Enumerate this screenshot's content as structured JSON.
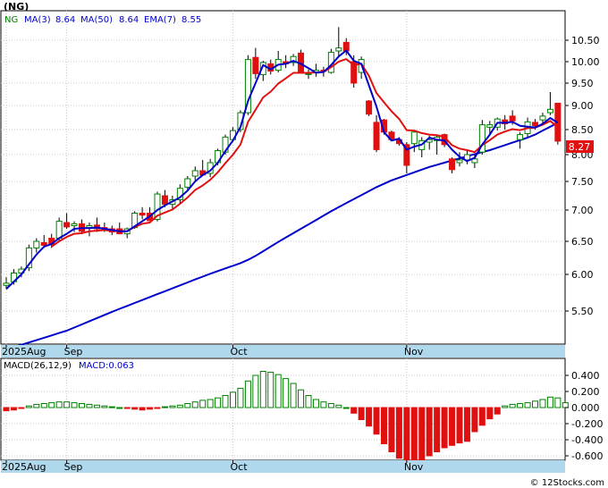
{
  "chart_data": [
    {
      "type": "candlestick",
      "symbol": "(NG)",
      "legend": [
        {
          "text": "NG",
          "color": "#008000"
        },
        {
          "text": "MA(3)",
          "color": "#0000cc"
        },
        {
          "text": "8.64",
          "color": "#0000cc"
        },
        {
          "text": "MA(50)",
          "color": "#0000cc"
        },
        {
          "text": "8.64",
          "color": "#0000cc"
        },
        {
          "text": "EMA(7)",
          "color": "#0000cc"
        },
        {
          "text": "8.55",
          "color": "#0000cc"
        }
      ],
      "last_price": "8.27",
      "y_ticks": [
        "10.50",
        "10.00",
        "9.50",
        "9.00",
        "8.50",
        "8.00",
        "7.50",
        "7.00",
        "6.50",
        "6.00",
        "5.50"
      ],
      "y_tick_values": [
        10.5,
        10.0,
        9.5,
        9.0,
        8.5,
        8.0,
        7.5,
        7.0,
        6.5,
        6.0,
        5.5
      ],
      "x_labels": [
        {
          "label": "2025Aug",
          "index": 0
        },
        {
          "label": "Sep",
          "index": 8
        },
        {
          "label": "Oct",
          "index": 30
        },
        {
          "label": "Nov",
          "index": 53
        }
      ],
      "candles": [
        [
          5.85,
          5.96,
          5.8,
          5.88
        ],
        [
          5.9,
          6.08,
          5.86,
          6.02
        ],
        [
          6.02,
          6.12,
          5.96,
          6.08
        ],
        [
          6.1,
          6.45,
          6.05,
          6.4
        ],
        [
          6.4,
          6.55,
          6.33,
          6.5
        ],
        [
          6.48,
          6.6,
          6.4,
          6.44
        ],
        [
          6.55,
          6.62,
          6.4,
          6.45
        ],
        [
          6.55,
          6.88,
          6.5,
          6.82
        ],
        [
          6.8,
          6.95,
          6.7,
          6.73
        ],
        [
          6.75,
          6.82,
          6.65,
          6.78
        ],
        [
          6.78,
          6.85,
          6.62,
          6.66
        ],
        [
          6.72,
          6.8,
          6.58,
          6.75
        ],
        [
          6.76,
          6.88,
          6.65,
          6.7
        ],
        [
          6.72,
          6.8,
          6.65,
          6.7
        ],
        [
          6.7,
          6.75,
          6.6,
          6.65
        ],
        [
          6.7,
          6.8,
          6.62,
          6.62
        ],
        [
          6.62,
          6.72,
          6.55,
          6.7
        ],
        [
          6.72,
          6.98,
          6.7,
          6.95
        ],
        [
          6.95,
          7.05,
          6.85,
          6.92
        ],
        [
          6.95,
          7.05,
          6.88,
          6.83
        ],
        [
          6.85,
          7.32,
          6.82,
          7.28
        ],
        [
          7.25,
          7.35,
          7.05,
          7.1
        ],
        [
          7.1,
          7.25,
          7.02,
          7.18
        ],
        [
          7.18,
          7.45,
          7.1,
          7.38
        ],
        [
          7.4,
          7.6,
          7.35,
          7.55
        ],
        [
          7.6,
          7.78,
          7.52,
          7.7
        ],
        [
          7.7,
          7.9,
          7.6,
          7.62
        ],
        [
          7.65,
          7.92,
          7.58,
          7.85
        ],
        [
          7.85,
          8.12,
          7.8,
          8.08
        ],
        [
          8.05,
          8.4,
          8.0,
          8.35
        ],
        [
          8.3,
          8.55,
          8.25,
          8.48
        ],
        [
          8.5,
          8.9,
          8.45,
          8.85
        ],
        [
          8.85,
          10.15,
          8.8,
          10.05
        ],
        [
          10.1,
          10.32,
          9.6,
          9.72
        ],
        [
          9.7,
          10.02,
          9.55,
          9.98
        ],
        [
          9.95,
          10.05,
          9.7,
          9.78
        ],
        [
          9.8,
          10.25,
          9.75,
          10.05
        ],
        [
          10.0,
          10.15,
          9.85,
          9.95
        ],
        [
          9.98,
          10.18,
          9.9,
          10.12
        ],
        [
          10.2,
          10.28,
          9.72,
          9.76
        ],
        [
          9.7,
          9.82,
          9.6,
          9.72
        ],
        [
          9.75,
          9.95,
          9.65,
          9.8
        ],
        [
          9.8,
          9.88,
          9.65,
          9.78
        ],
        [
          9.75,
          10.3,
          9.72,
          10.22
        ],
        [
          10.25,
          10.82,
          10.1,
          10.32
        ],
        [
          10.45,
          10.55,
          10.15,
          10.25
        ],
        [
          10.0,
          10.15,
          9.4,
          9.5
        ],
        [
          9.75,
          10.12,
          9.6,
          10.05
        ],
        [
          9.1,
          9.12,
          8.78,
          8.82
        ],
        [
          8.65,
          8.8,
          8.05,
          8.1
        ],
        [
          8.7,
          8.72,
          8.4,
          8.45
        ],
        [
          8.45,
          8.48,
          8.28,
          8.3
        ],
        [
          8.3,
          8.35,
          8.18,
          8.22
        ],
        [
          8.2,
          8.25,
          7.65,
          7.8
        ],
        [
          8.22,
          8.48,
          8.05,
          8.45
        ],
        [
          8.1,
          8.35,
          7.95,
          8.28
        ],
        [
          8.25,
          8.38,
          8.1,
          8.3
        ],
        [
          8.28,
          8.4,
          8.0,
          8.35
        ],
        [
          8.4,
          8.42,
          8.15,
          8.2
        ],
        [
          7.92,
          7.95,
          7.65,
          7.72
        ],
        [
          7.85,
          8.05,
          7.78,
          7.9
        ],
        [
          7.9,
          8.1,
          7.82,
          8.0
        ],
        [
          7.85,
          8.0,
          7.75,
          7.92
        ],
        [
          8.05,
          8.7,
          8.0,
          8.6
        ],
        [
          8.55,
          8.68,
          8.42,
          8.6
        ],
        [
          8.55,
          8.75,
          8.48,
          8.72
        ],
        [
          8.7,
          8.8,
          8.5,
          8.62
        ],
        [
          8.78,
          8.9,
          8.6,
          8.68
        ],
        [
          8.3,
          8.45,
          8.12,
          8.4
        ],
        [
          8.42,
          8.75,
          8.35,
          8.66
        ],
        [
          8.65,
          8.72,
          8.5,
          8.58
        ],
        [
          8.7,
          8.85,
          8.62,
          8.78
        ],
        [
          8.85,
          9.3,
          8.8,
          8.92
        ],
        [
          9.05,
          9.05,
          8.2,
          8.27
        ]
      ],
      "series": [
        {
          "name": "MA(3)",
          "color": "#0000cc",
          "values": [
            5.8,
            5.9,
            6.0,
            6.15,
            6.3,
            6.42,
            6.46,
            6.55,
            6.62,
            6.7,
            6.71,
            6.71,
            6.72,
            6.7,
            6.68,
            6.66,
            6.66,
            6.74,
            6.82,
            6.9,
            7.0,
            7.08,
            7.15,
            7.22,
            7.34,
            7.5,
            7.62,
            7.7,
            7.85,
            8.07,
            8.28,
            8.55,
            9.1,
            9.5,
            9.92,
            9.82,
            9.93,
            9.95,
            10.02,
            9.95,
            9.85,
            9.74,
            9.76,
            9.92,
            10.12,
            10.26,
            10.02,
            9.95,
            9.45,
            8.98,
            8.45,
            8.28,
            8.32,
            8.1,
            8.16,
            8.2,
            8.34,
            8.3,
            8.28,
            8.1,
            7.96,
            7.88,
            7.94,
            8.2,
            8.4,
            8.64,
            8.64,
            8.66,
            8.58,
            8.56,
            8.54,
            8.62,
            8.74,
            8.64
          ]
        },
        {
          "name": "EMA(7)",
          "color": "#e01010",
          "values": [
            null,
            null,
            null,
            null,
            null,
            null,
            6.42,
            6.5,
            6.57,
            6.62,
            6.63,
            6.66,
            6.67,
            6.68,
            6.67,
            6.66,
            6.66,
            6.73,
            6.78,
            6.8,
            6.91,
            6.96,
            7.01,
            7.11,
            7.22,
            7.35,
            7.43,
            7.53,
            7.67,
            7.84,
            8.0,
            8.2,
            8.66,
            8.91,
            9.18,
            9.31,
            9.49,
            9.61,
            9.74,
            9.74,
            9.74,
            9.75,
            9.76,
            9.87,
            10.0,
            10.06,
            9.92,
            9.95,
            9.67,
            9.28,
            9.07,
            8.88,
            8.72,
            8.49,
            8.48,
            8.43,
            8.4,
            8.39,
            8.35,
            8.19,
            8.12,
            8.09,
            8.05,
            8.19,
            8.29,
            8.4,
            8.46,
            8.51,
            8.49,
            8.53,
            8.54,
            8.6,
            8.68,
            8.55
          ]
        },
        {
          "name": "MA(50)",
          "color": "#0000cc",
          "values": [
            5.02,
            5.04,
            5.07,
            5.1,
            5.13,
            5.16,
            5.19,
            5.22,
            5.25,
            5.29,
            5.33,
            5.37,
            5.41,
            5.45,
            5.49,
            5.53,
            5.57,
            5.61,
            5.65,
            5.69,
            5.73,
            5.77,
            5.81,
            5.85,
            5.89,
            5.93,
            5.97,
            6.01,
            6.05,
            6.09,
            6.13,
            6.17,
            6.22,
            6.28,
            6.35,
            6.42,
            6.49,
            6.56,
            6.63,
            6.7,
            6.77,
            6.84,
            6.91,
            6.98,
            7.05,
            7.12,
            7.19,
            7.26,
            7.33,
            7.4,
            7.46,
            7.52,
            7.57,
            7.62,
            7.67,
            7.72,
            7.77,
            7.81,
            7.85,
            7.89,
            7.93,
            7.97,
            8.01,
            8.05,
            8.09,
            8.14,
            8.19,
            8.24,
            8.29,
            8.34,
            8.4,
            8.48,
            8.56,
            8.64
          ]
        }
      ]
    },
    {
      "type": "bar",
      "legend": [
        {
          "text": "MACD(26,12,9)",
          "color": "#000000"
        },
        {
          "text": "MACD:0.063",
          "color": "#0000cc"
        }
      ],
      "y_ticks": [
        "0.400",
        "0.200",
        "0.000",
        "-0.200",
        "-0.400",
        "-0.600"
      ],
      "y_tick_values": [
        0.4,
        0.2,
        0.0,
        -0.2,
        -0.4,
        -0.6
      ],
      "values": [
        -0.04,
        -0.03,
        -0.01,
        0.02,
        0.04,
        0.05,
        0.06,
        0.07,
        0.07,
        0.06,
        0.05,
        0.04,
        0.03,
        0.02,
        0.01,
        0.0,
        -0.01,
        -0.02,
        -0.03,
        -0.02,
        -0.01,
        0.01,
        0.02,
        0.03,
        0.05,
        0.07,
        0.09,
        0.1,
        0.12,
        0.15,
        0.19,
        0.24,
        0.33,
        0.4,
        0.45,
        0.44,
        0.41,
        0.36,
        0.3,
        0.22,
        0.15,
        0.1,
        0.07,
        0.05,
        0.03,
        0.0,
        -0.07,
        -0.15,
        -0.23,
        -0.33,
        -0.45,
        -0.55,
        -0.63,
        -0.68,
        -0.68,
        -0.65,
        -0.6,
        -0.55,
        -0.5,
        -0.47,
        -0.44,
        -0.42,
        -0.3,
        -0.22,
        -0.14,
        -0.08,
        0.02,
        0.04,
        0.05,
        0.06,
        0.08,
        0.1,
        0.13,
        0.12,
        0.06
      ]
    }
  ],
  "shared_x_labels": [
    "2025Aug",
    "Sep",
    "Oct",
    "Nov"
  ],
  "watermark": "© 12Stocks.com"
}
